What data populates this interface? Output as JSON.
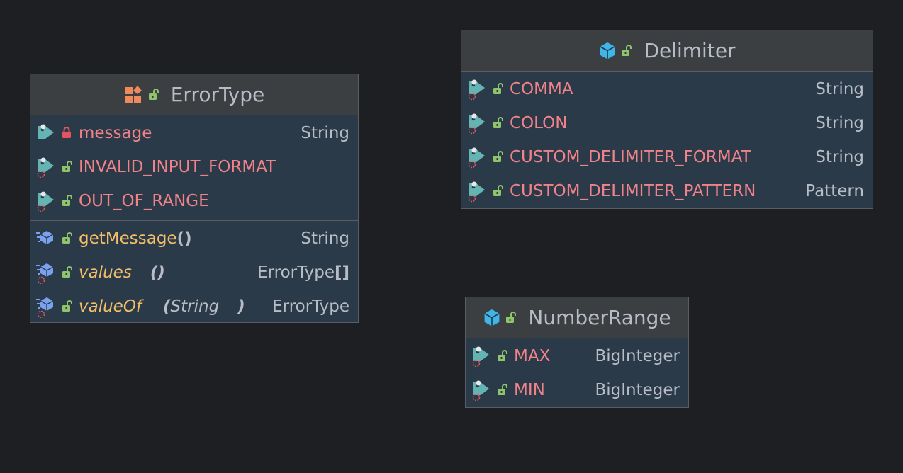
{
  "diagram": {
    "classes": [
      {
        "name": "ErrorType",
        "kind": "enum",
        "fields": [
          {
            "name": "message",
            "type": "String",
            "access": "private"
          },
          {
            "name": "INVALID_INPUT_FORMAT",
            "type": "",
            "access": "public"
          },
          {
            "name": "OUT_OF_RANGE",
            "type": "",
            "access": "public"
          }
        ],
        "methods": [
          {
            "name": "getMessage",
            "params": "",
            "return": "String"
          },
          {
            "name": "values",
            "params": "",
            "return": "ErrorType",
            "return_suffix": "[]"
          },
          {
            "name": "valueOf",
            "params": "String",
            "return": "ErrorType"
          }
        ]
      },
      {
        "name": "Delimiter",
        "kind": "class",
        "fields": [
          {
            "name": "COMMA",
            "type": "String",
            "access": "public"
          },
          {
            "name": "COLON",
            "type": "String",
            "access": "public"
          },
          {
            "name": "CUSTOM_DELIMITER_FORMAT",
            "type": "String",
            "access": "public"
          },
          {
            "name": "CUSTOM_DELIMITER_PATTERN",
            "type": "Pattern",
            "access": "public"
          }
        ]
      },
      {
        "name": "NumberRange",
        "kind": "class",
        "fields": [
          {
            "name": "MAX",
            "type": "BigInteger",
            "access": "public"
          },
          {
            "name": "MIN",
            "type": "BigInteger",
            "access": "public"
          }
        ]
      }
    ],
    "symbols": {
      "paren_open": "(",
      "paren_close": ")",
      "empty_parens": "()"
    }
  },
  "colors": {
    "background": "#1e1f22",
    "body": "#2b3a48",
    "header": "#3c3f41",
    "field_name": "#f0828a",
    "method_name": "#f4bf68",
    "type": "#b7bcc5",
    "public_lock": "#8fc46a",
    "private_lock": "#e05560",
    "class_icon": "#3fb5e8",
    "enum_icon": "#f08a5d"
  },
  "icons": [
    "enum-icon",
    "class-icon",
    "field-tag-icon",
    "static-field-tag-icon",
    "method-icon",
    "static-method-icon",
    "public-lock-icon",
    "private-lock-icon"
  ]
}
